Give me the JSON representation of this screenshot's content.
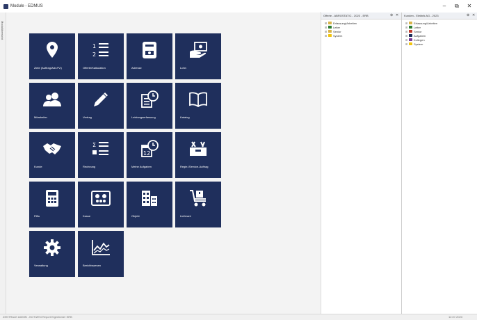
{
  "window": {
    "title": "Module - EDMUS",
    "minimize": "–",
    "restore": "⧉",
    "close": "✕"
  },
  "sidebar_strip": {
    "label": "Modulübersicht"
  },
  "tiles": [
    {
      "id": "ziele",
      "label": "Ziele (Auftrag/Adr./PZ)",
      "icon": "map-pin-icon"
    },
    {
      "id": "offerte",
      "label": "Offerte/Kalkulation",
      "icon": "numbered-list-icon"
    },
    {
      "id": "adresse",
      "label": "Adresse",
      "icon": "phone-book-icon"
    },
    {
      "id": "lohn",
      "label": "Lohn",
      "icon": "money-hand-icon"
    },
    {
      "id": "mitarbeiter",
      "label": "Mitarbeiter",
      "icon": "users-icon"
    },
    {
      "id": "vertrag",
      "label": "Vertrag",
      "icon": "pencil-icon"
    },
    {
      "id": "leistung",
      "label": "Leistungserfassung",
      "icon": "clock-document-icon"
    },
    {
      "id": "katalog",
      "label": "Katalog",
      "icon": "book-icon"
    },
    {
      "id": "kunde",
      "label": "Kunde",
      "icon": "handshake-icon"
    },
    {
      "id": "rechnung",
      "label": "Rechnung",
      "icon": "sum-list-icon"
    },
    {
      "id": "aufgaben",
      "label": "Meine Aufgaben",
      "icon": "calendar-clock-icon"
    },
    {
      "id": "regie",
      "label": "Regie-/Service-Auftrag",
      "icon": "toolbox-icon"
    },
    {
      "id": "fibu",
      "label": "FiBu",
      "icon": "calculator-icon"
    },
    {
      "id": "kasse",
      "label": "Kasse",
      "icon": "cashbox-icon"
    },
    {
      "id": "objekt",
      "label": "Objekt",
      "icon": "building-icon"
    },
    {
      "id": "lieferant",
      "label": "Lieferant",
      "icon": "cart-icon"
    },
    {
      "id": "verwaltung",
      "label": "Verwaltung",
      "icon": "gear-icon"
    },
    {
      "id": "berichtswesen",
      "label": "Berichtswesen",
      "icon": "line-chart-icon"
    }
  ],
  "panel1": {
    "title": "Offerte - ABROSTATIC - 2023 - ERB",
    "pin": "⊕",
    "close": "✕",
    "nodes": [
      {
        "label": "Erfassung/Arbeiten",
        "color": "#d9b44a"
      },
      {
        "label": "Leiter",
        "color": "#2e7d32"
      },
      {
        "label": "Senior",
        "color": "#d9b44a"
      },
      {
        "label": "System",
        "color": "#f1c40f"
      }
    ]
  },
  "panel2": {
    "title": "Kunden - Elektrik AG - 2023",
    "pin": "⊕",
    "close": "✕",
    "nodes": [
      {
        "label": "Erfassung/Arbeiten",
        "color": "#d9b44a"
      },
      {
        "label": "Leiter",
        "color": "#2e7d32"
      },
      {
        "label": "Senior",
        "color": "#c0392b"
      },
      {
        "label": "Aufgaben",
        "color": "#1f2f5c"
      },
      {
        "label": "Kollegen",
        "color": "#7d3c98"
      },
      {
        "label": "System",
        "color": "#f1c40f"
      }
    ]
  },
  "status": {
    "left": "ZENTRALE ADMIN - NOTIZEN Report Eigentümer ERB",
    "right": "12.07.2023"
  }
}
